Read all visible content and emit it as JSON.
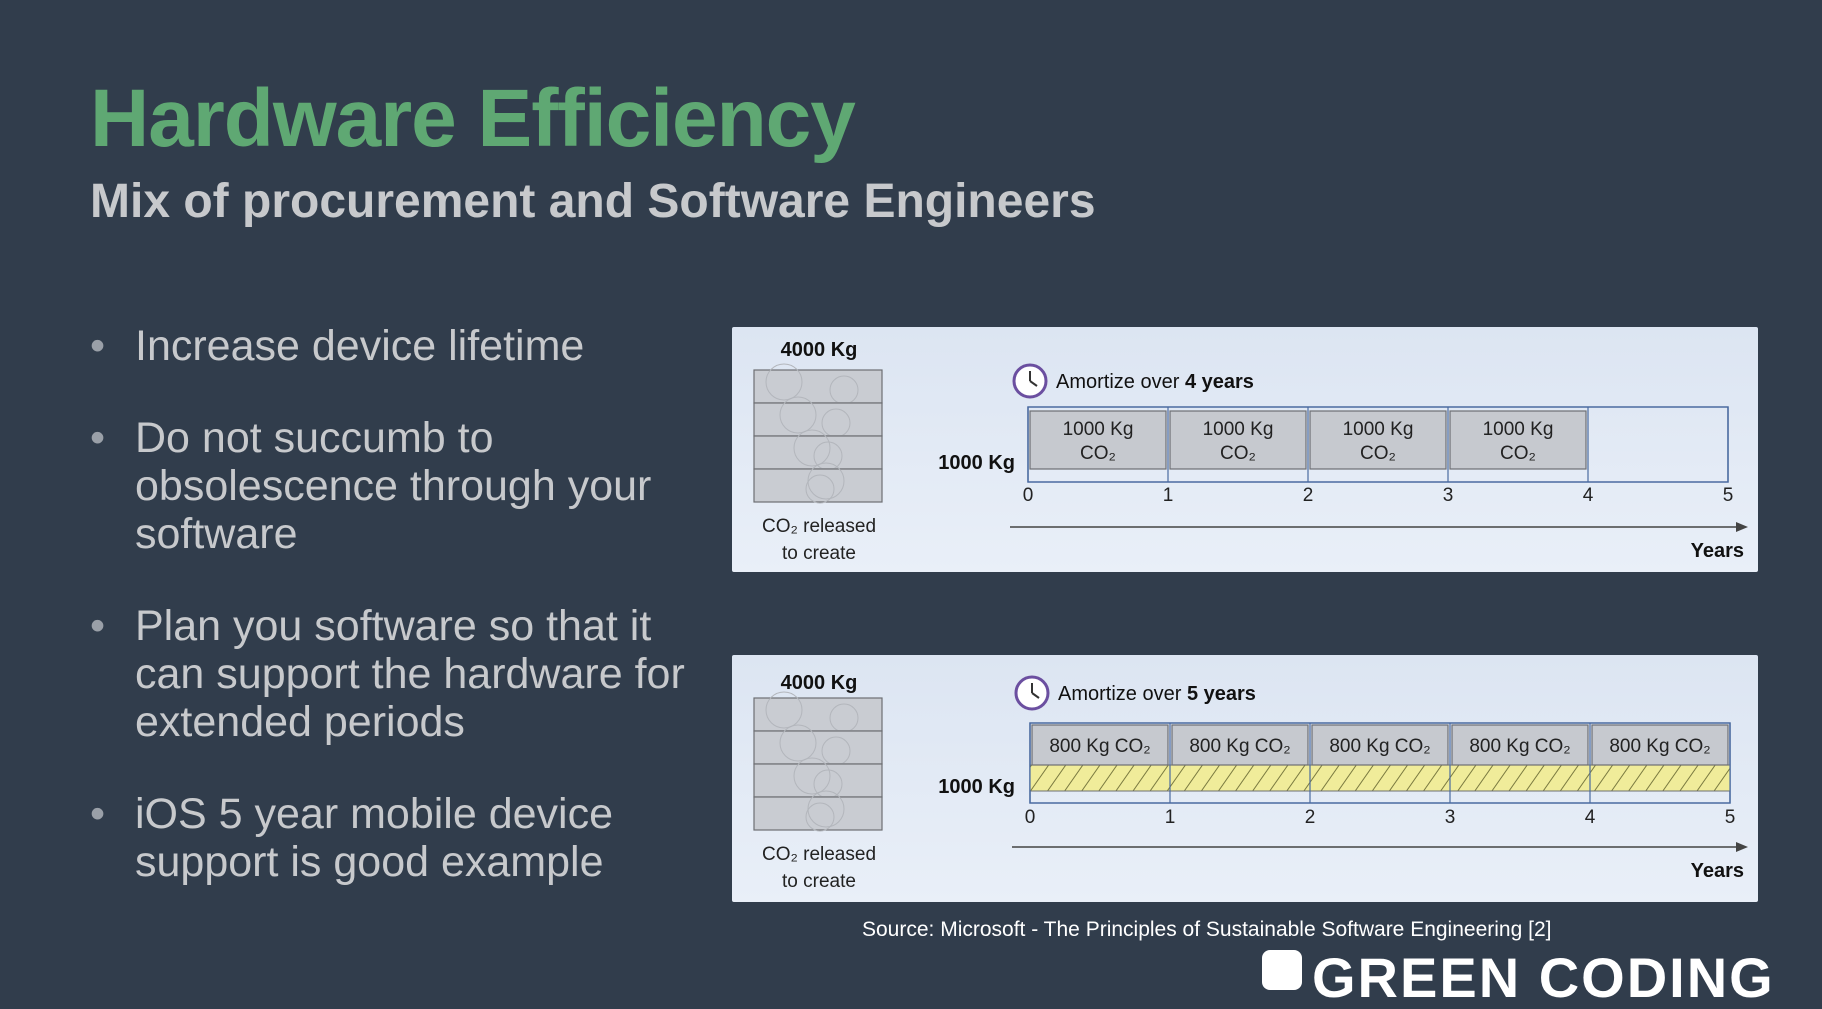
{
  "title": "Hardware Efficiency",
  "subtitle": "Mix of procurement and Software Engineers",
  "bullets": [
    "Increase device lifetime",
    "Do not succumb to obsolescence through your software",
    "Plan you software so that it can support the hardware for extended periods",
    "iOS 5 year mobile device support is good example"
  ],
  "diagrams": [
    {
      "total_label": "4000 Kg",
      "released_label_line1": "CO₂ released",
      "released_label_line2": "to create",
      "amortize_prefix": "Amortize over ",
      "amortize_bold": "4 years",
      "scale_label": "1000 Kg",
      "segments": [
        "1000 Kg CO₂",
        "1000 Kg CO₂",
        "1000 Kg CO₂",
        "1000 Kg CO₂"
      ],
      "amortize_years": 4,
      "ticks": [
        "0",
        "1",
        "2",
        "3",
        "4",
        "5"
      ],
      "axis_label": "Years",
      "hatched": false
    },
    {
      "total_label": "4000 Kg",
      "released_label_line1": "CO₂ released",
      "released_label_line2": "to create",
      "amortize_prefix": "Amortize over ",
      "amortize_bold": "5 years",
      "scale_label": "1000 Kg",
      "segments": [
        "800 Kg CO₂",
        "800 Kg CO₂",
        "800 Kg CO₂",
        "800 Kg CO₂",
        "800 Kg CO₂"
      ],
      "amortize_years": 5,
      "ticks": [
        "0",
        "1",
        "2",
        "3",
        "4",
        "5"
      ],
      "axis_label": "Years",
      "hatched": true
    }
  ],
  "source": "Source: Microsoft -  The Principles of Sustainable Software Engineering [2]",
  "brand": "GREEN CODING",
  "colors": {
    "background": "#313d4c",
    "title": "#5fa873",
    "panel": "#e2e9f4",
    "hatch": "#f0ec9a",
    "clock": "#6b4fa0"
  }
}
